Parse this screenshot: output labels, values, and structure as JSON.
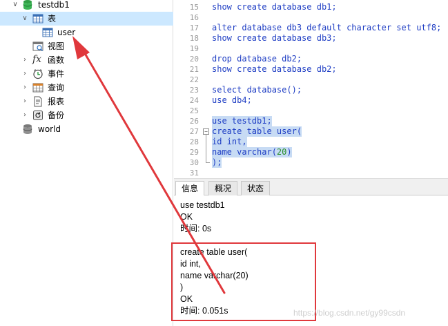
{
  "tree": {
    "items": [
      {
        "label": "testdb1",
        "icon": "database-icon",
        "expanded": true
      },
      {
        "label": "表",
        "icon": "table-icon",
        "expanded": true,
        "selected": true
      },
      {
        "label": "user",
        "icon": "table-icon"
      },
      {
        "label": "视图",
        "icon": "view-icon"
      },
      {
        "label": "函数",
        "icon": "function-icon"
      },
      {
        "label": "事件",
        "icon": "event-icon"
      },
      {
        "label": "查询",
        "icon": "query-icon"
      },
      {
        "label": "报表",
        "icon": "report-icon"
      },
      {
        "label": "备份",
        "icon": "backup-icon"
      },
      {
        "label": "world",
        "icon": "database-icon"
      }
    ]
  },
  "editor": {
    "lines": [
      {
        "n": "15",
        "code": "show create database db1;"
      },
      {
        "n": "16",
        "code": ""
      },
      {
        "n": "17",
        "code": "alter database db3 default character set utf8;"
      },
      {
        "n": "18",
        "code": "show create database db3;"
      },
      {
        "n": "19",
        "code": ""
      },
      {
        "n": "20",
        "code": "drop database db2;"
      },
      {
        "n": "21",
        "code": "show create database db2;"
      },
      {
        "n": "22",
        "code": ""
      },
      {
        "n": "23",
        "code": "select database();"
      },
      {
        "n": "24",
        "code": "use db4;"
      },
      {
        "n": "25",
        "code": ""
      },
      {
        "n": "26",
        "code": "use testdb1;"
      },
      {
        "n": "27",
        "code": "create table user("
      },
      {
        "n": "28",
        "code": "id int,"
      },
      {
        "n": "29",
        "code": "name varchar(20)"
      },
      {
        "n": "30",
        "code": ");"
      },
      {
        "n": "31",
        "code": ""
      }
    ]
  },
  "tabs": [
    "信息",
    "概况",
    "状态"
  ],
  "messages": [
    "use testdb1",
    "OK",
    "时间: 0s",
    "",
    "create table user(",
    "id int,",
    "name varchar(20)",
    ")",
    "OK",
    "时间: 0.051s"
  ],
  "watermark": "https://blog.csdn.net/gy99csdn",
  "colors": {
    "selection": "#cce8ff",
    "highlight": "#c7dbf4",
    "keyword": "#1f3ec4",
    "annotation": "#e0383c"
  }
}
